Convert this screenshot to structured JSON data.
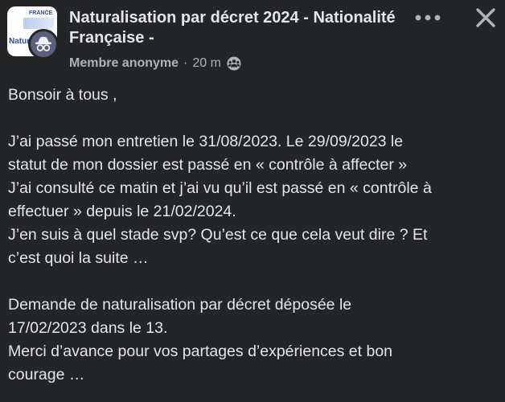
{
  "post": {
    "group_thumb": {
      "brand_text_top": "FRANCE",
      "brand_text_left": "Natur"
    },
    "title": "Naturalisation par décret 2024 - Nationalité Française -",
    "author": "Membre anonyme",
    "separator": "·",
    "time": "20 m",
    "privacy_icon": "group-audience-icon",
    "more_icon": "more-horizontal-icon",
    "close_icon": "close-icon",
    "body": {
      "paragraphs": [
        {
          "lines": [
            "Bonsoir à tous ,"
          ]
        },
        {
          "lines": [
            "J’ai passé mon entretien le 31/08/2023. Le 29/09/2023 le",
            "statut de mon dossier est passé en  « contrôle à affecter »",
            "J’ai consulté ce matin et j’ai vu qu’il est passé en « contrôle à",
            "effectuer » depuis le 21/02/2024.",
            "J’en suis à quel stade svp? Qu’est ce que cela veut dire ? Et",
            "c’est quoi la suite …"
          ]
        },
        {
          "lines": [
            "Demande de naturalisation par décret déposée le",
            "17/02/2023 dans le 13.",
            "Merci d’avance pour vos partages d’expériences et bon",
            "courage …"
          ]
        }
      ]
    },
    "colors": {
      "background": "#242526",
      "primary_text": "#e4e6eb",
      "secondary_text": "#b0b3b8",
      "anon_avatar": "#5a5f7a"
    }
  }
}
